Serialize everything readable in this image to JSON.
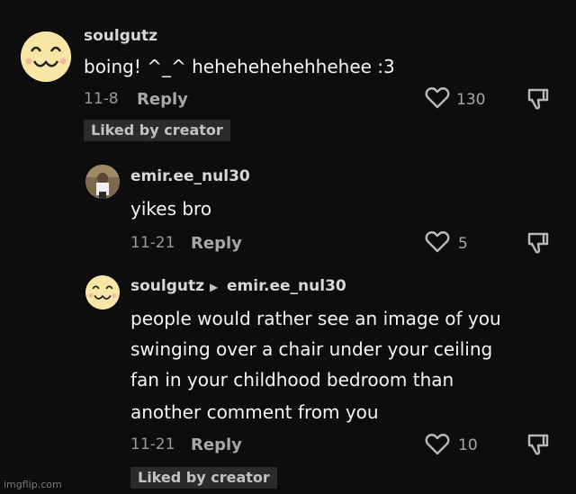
{
  "comments": [
    {
      "username": "soulgutz",
      "text": "boing! ^_^ hehehehehehhehee :3",
      "date": "11-8",
      "reply_label": "Reply",
      "likes": "130",
      "badge": "Liked by creator"
    },
    {
      "username": "emir.ee_nul30",
      "text": "yikes bro",
      "date": "11-21",
      "reply_label": "Reply",
      "likes": "5"
    },
    {
      "username": "soulgutz",
      "reply_to": "emir.ee_nul30",
      "text_lines": [
        "people would rather see an image of you",
        "swinging over a chair under your ceiling",
        "fan in your childhood bedroom than",
        "another comment from you"
      ],
      "date": "11-21",
      "reply_label": "Reply",
      "likes": "10",
      "badge": "Liked by creator"
    }
  ],
  "watermark": "imgflip.com",
  "icons": {
    "avatar_soulgutz": "smiley-face-icon",
    "like": "heart-icon",
    "dislike": "thumbs-down-icon",
    "reply_arrow": "play-triangle-icon"
  }
}
